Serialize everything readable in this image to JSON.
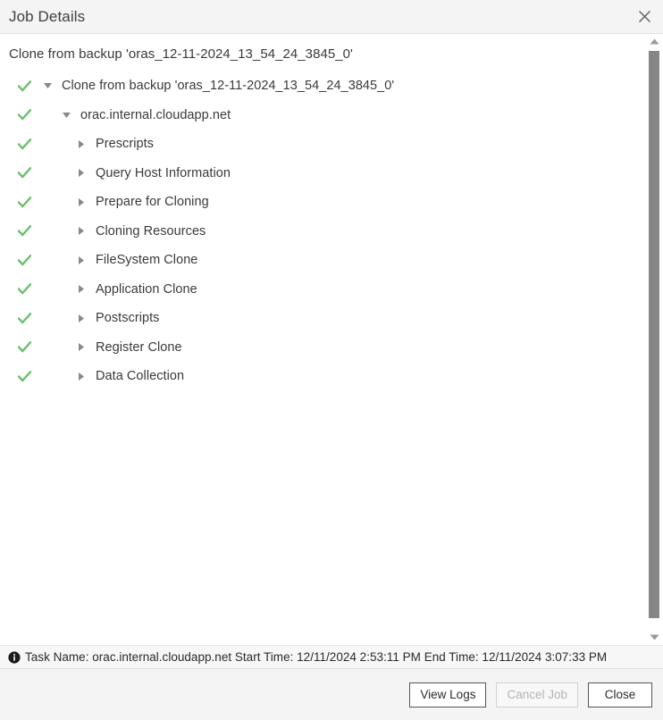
{
  "window": {
    "title": "Job Details",
    "close_icon": "close-icon"
  },
  "main": {
    "job_heading": "Clone from backup 'oras_12-11-2024_13_54_24_3845_0'",
    "tree": [
      {
        "label": "Clone from backup 'oras_12-11-2024_13_54_24_3845_0'",
        "depth": 0,
        "status": "success",
        "expander": "expanded"
      },
      {
        "label": "orac.internal.cloudapp.net",
        "depth": 1,
        "status": "success",
        "expander": "expanded"
      },
      {
        "label": "Prescripts",
        "depth": 2,
        "status": "success",
        "expander": "collapsed"
      },
      {
        "label": "Query Host Information",
        "depth": 2,
        "status": "success",
        "expander": "collapsed"
      },
      {
        "label": "Prepare for Cloning",
        "depth": 2,
        "status": "success",
        "expander": "collapsed"
      },
      {
        "label": "Cloning Resources",
        "depth": 2,
        "status": "success",
        "expander": "collapsed"
      },
      {
        "label": "FileSystem Clone",
        "depth": 2,
        "status": "success",
        "expander": "collapsed"
      },
      {
        "label": "Application Clone",
        "depth": 2,
        "status": "success",
        "expander": "collapsed"
      },
      {
        "label": "Postscripts",
        "depth": 2,
        "status": "success",
        "expander": "collapsed"
      },
      {
        "label": "Register Clone",
        "depth": 2,
        "status": "success",
        "expander": "collapsed"
      },
      {
        "label": "Data Collection",
        "depth": 2,
        "status": "success",
        "expander": "collapsed"
      }
    ]
  },
  "statusbar": {
    "icon": "info-icon",
    "text": "Task Name: orac.internal.cloudapp.net Start Time: 12/11/2024 2:53:11 PM End Time: 12/11/2024 3:07:33 PM"
  },
  "footer": {
    "view_logs_label": "View Logs",
    "cancel_job_label": "Cancel Job",
    "close_label": "Close"
  },
  "scrollbar": {
    "up_icon": "scroll-up-arrow-icon",
    "down_icon": "scroll-down-arrow-icon"
  },
  "colors": {
    "success_check": "#6cbf6c",
    "titlebar_bg": "#f4f4f4",
    "text": "#3a3a3a",
    "scrollbar_thumb": "#868686"
  }
}
